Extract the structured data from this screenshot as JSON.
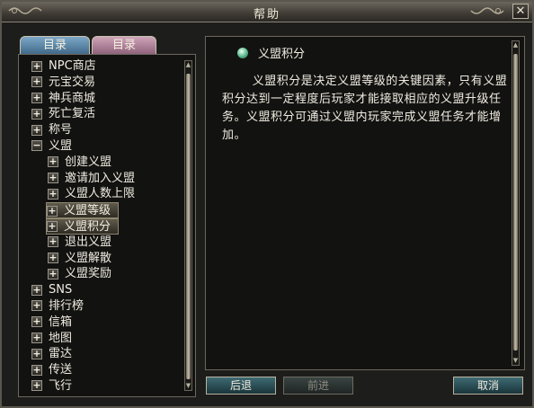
{
  "window": {
    "title": "帮助",
    "close_glyph": "✕"
  },
  "tabs": [
    {
      "label": "目录"
    },
    {
      "label": "目录"
    }
  ],
  "tree": {
    "items": [
      {
        "label": "NPC商店",
        "expander": "+"
      },
      {
        "label": "元宝交易",
        "expander": "+"
      },
      {
        "label": "神兵商城",
        "expander": "+"
      },
      {
        "label": "死亡复活",
        "expander": "+"
      },
      {
        "label": "称号",
        "expander": "+"
      },
      {
        "label": "义盟",
        "expander": "−"
      },
      {
        "label": "创建义盟",
        "expander": "+"
      },
      {
        "label": "邀请加入义盟",
        "expander": "+"
      },
      {
        "label": "义盟人数上限",
        "expander": "+"
      },
      {
        "label": "义盟等级",
        "expander": "+"
      },
      {
        "label": "义盟积分",
        "expander": "+"
      },
      {
        "label": "退出义盟",
        "expander": "+"
      },
      {
        "label": "义盟解散",
        "expander": "+"
      },
      {
        "label": "义盟奖励",
        "expander": "+"
      },
      {
        "label": "SNS",
        "expander": "+"
      },
      {
        "label": "排行榜",
        "expander": "+"
      },
      {
        "label": "信箱",
        "expander": "+"
      },
      {
        "label": "地图",
        "expander": "+"
      },
      {
        "label": "雷达",
        "expander": "+"
      },
      {
        "label": "传送",
        "expander": "+"
      },
      {
        "label": "飞行",
        "expander": "+"
      }
    ]
  },
  "content": {
    "title": "义盟积分",
    "body": "义盟积分是决定义盟等级的关键因素，只有义盟积分达到一定程度后玩家才能接取相应的义盟升级任务。义盟积分可通过义盟内玩家完成义盟任务才能增加。"
  },
  "buttons": {
    "back": "后退",
    "forward": "前进",
    "cancel": "取消"
  },
  "scroll": {
    "up_glyph": "▲",
    "down_glyph": "▼"
  },
  "colors": {
    "accent": "#3f6b73",
    "tab_active": "#7da7c7",
    "tab_other": "#cfa5b9"
  }
}
